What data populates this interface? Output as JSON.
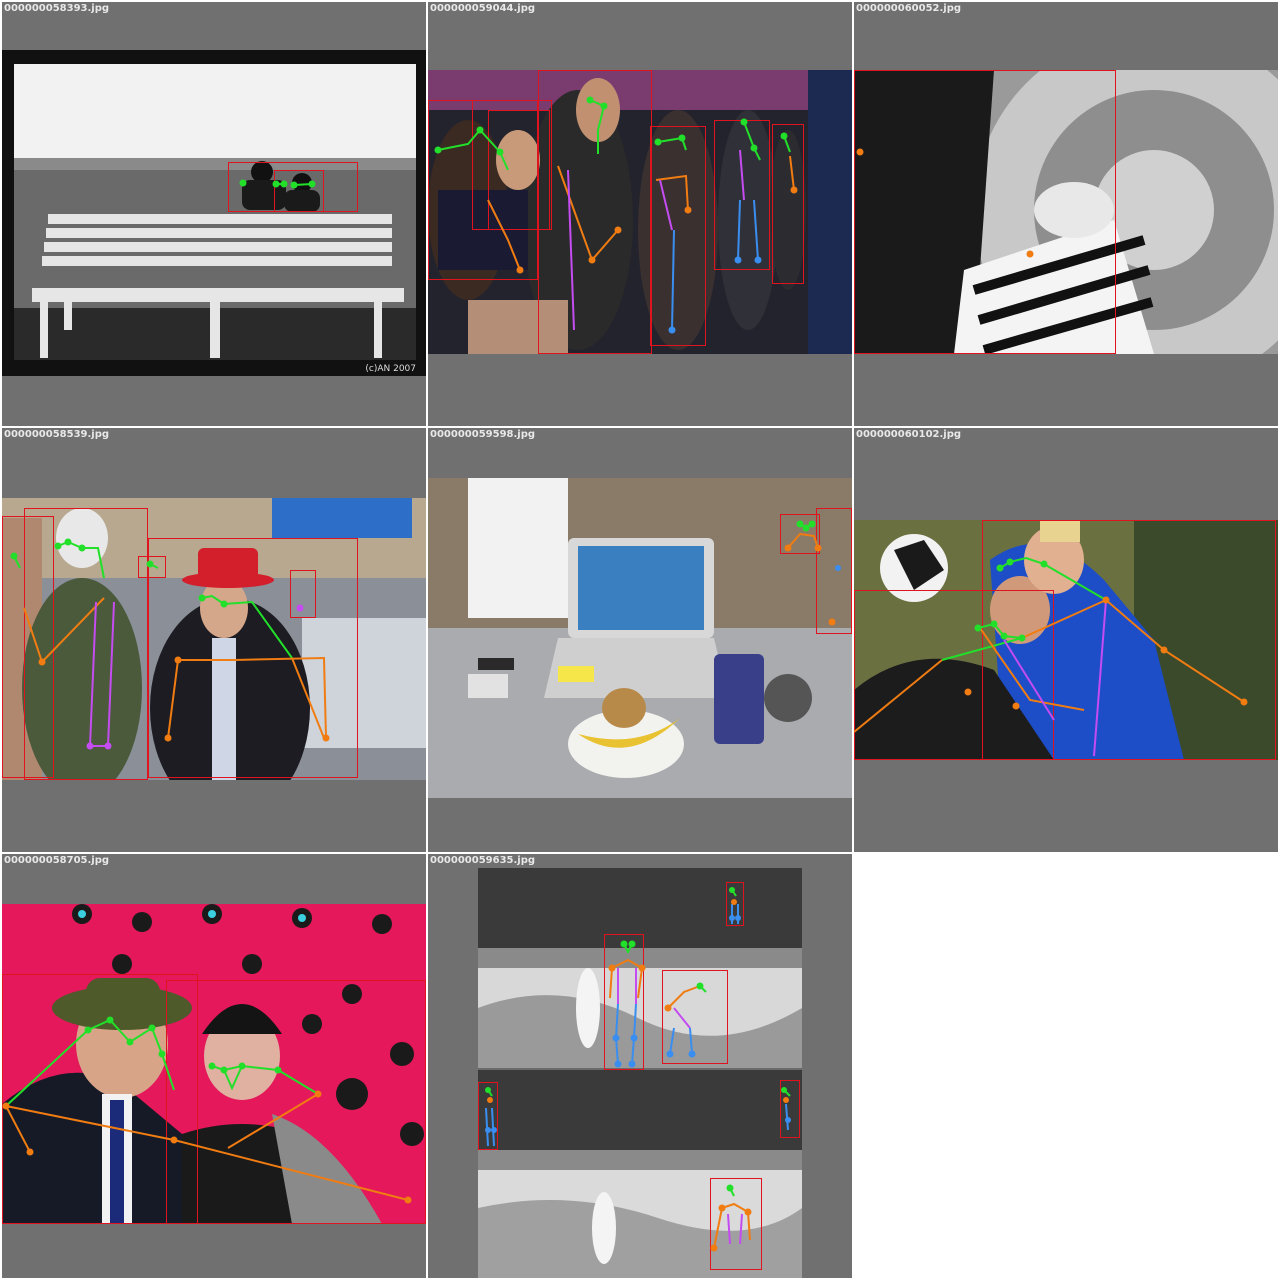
{
  "tiles": [
    {
      "filename": "000000058393.jpg",
      "watermark": "(c)AN 2007"
    },
    {
      "filename": "000000059044.jpg"
    },
    {
      "filename": "000000060052.jpg"
    },
    {
      "filename": "000000058539.jpg"
    },
    {
      "filename": "000000059598.jpg"
    },
    {
      "filename": "000000060102.jpg"
    },
    {
      "filename": "000000058705.jpg"
    },
    {
      "filename": "000000059635.jpg"
    }
  ],
  "colors": {
    "bbox": "#e0141e",
    "keypoint_head": "#22e02a",
    "keypoint_arm": "#f07c12",
    "keypoint_torso": "#c44cf0",
    "keypoint_leg": "#3a8ef0",
    "tile_background": "#707070"
  }
}
